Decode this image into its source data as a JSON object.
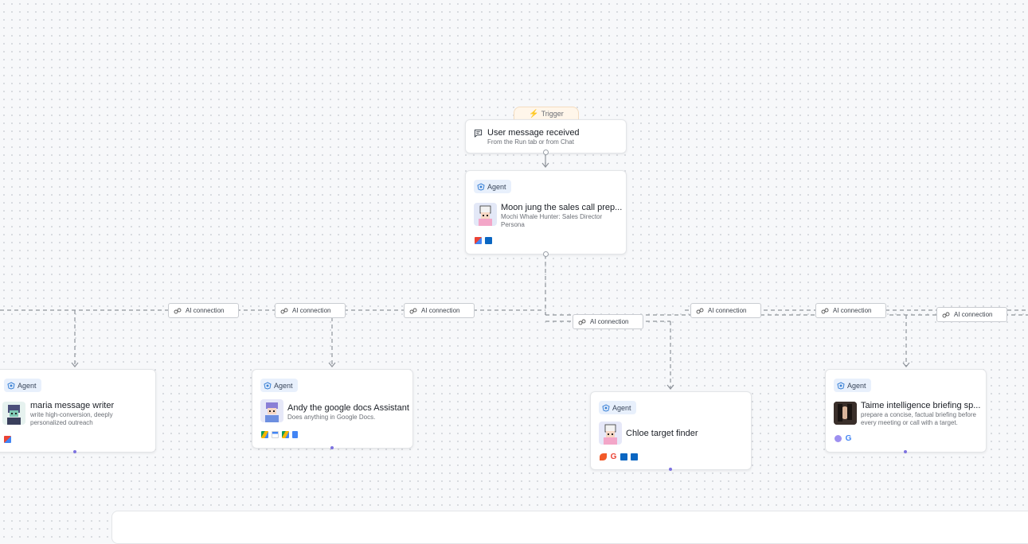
{
  "trigger": {
    "tab_label": "Trigger",
    "title": "User message received",
    "subtitle": "From the Run tab or from Chat",
    "icon": "chat-bubble-icon"
  },
  "main_agent": {
    "badge": "Agent",
    "title": "Moon jung the sales call prep...",
    "subtitle": "Mochi Whale Hunter: Sales Director Persona",
    "tools": [
      "gmail-icon",
      "linkedin-icon"
    ]
  },
  "connections": [
    {
      "label": "AI connection"
    },
    {
      "label": "AI connection"
    },
    {
      "label": "AI connection"
    },
    {
      "label": "AI connection"
    },
    {
      "label": "AI connection"
    },
    {
      "label": "AI connection"
    },
    {
      "label": "AI connection"
    }
  ],
  "agents": [
    {
      "badge": "Agent",
      "title": "maria message writer",
      "subtitle": "write high-conversion, deeply personalized outreach",
      "tools": [
        "gmail-icon"
      ]
    },
    {
      "badge": "Agent",
      "title": "Andy the google docs Assistant",
      "subtitle": "Does anything in Google Docs.",
      "tools": [
        "google-drive-icon",
        "google-calendar-icon",
        "google-drive-icon",
        "google-docs-icon"
      ]
    },
    {
      "badge": "Agent",
      "title": "Chloe target finder",
      "subtitle": "",
      "tools": [
        "apollo-icon",
        "google-icon",
        "linkedin-icon",
        "linkedin-icon"
      ]
    },
    {
      "badge": "Agent",
      "title": "Taime intelligence briefing sp...",
      "subtitle": "prepare a concise, factual briefing before every meeting or call with a target.",
      "tools": [
        "perplexity-icon",
        "google-icon"
      ]
    }
  ],
  "colors": {
    "accent_dot": "#7d72e0",
    "badge_bg": "#e8f0fc",
    "trigger_tab_bg": "#fff6ea"
  }
}
